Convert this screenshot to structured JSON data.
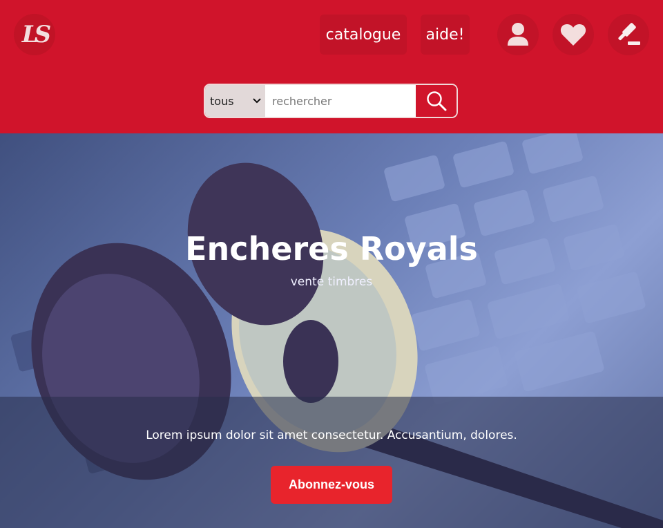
{
  "header": {
    "logo_text": "LS",
    "nav": {
      "catalogue": "catalogue",
      "aide": "aide!"
    },
    "icons": [
      "user-icon",
      "heart-icon",
      "gavel-icon"
    ]
  },
  "search": {
    "category_selected": "tous",
    "placeholder": "rechercher"
  },
  "hero": {
    "title": "Encheres Royals",
    "subtitle": "vente timbres",
    "tagline": "Lorem ipsum dolor sit amet consectetur. Accusantium, dolores.",
    "cta_label": "Abonnez-vous"
  },
  "colors": {
    "brand_red": "#d0142b",
    "cta_red": "#e8242c"
  }
}
